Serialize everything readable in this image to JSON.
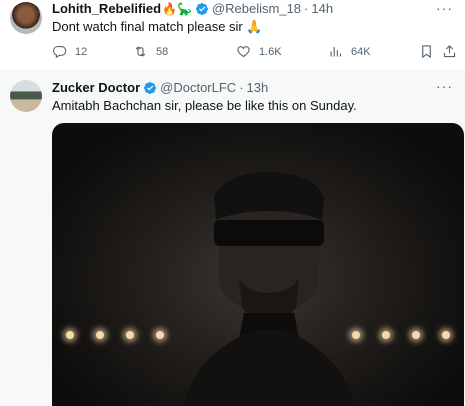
{
  "tweet1": {
    "name": "Lohith_Rebelified",
    "emojis": "🔥🦕",
    "handle": "@Rebelism_18",
    "time": "14h",
    "text": "Dont watch final match please sir 🙏",
    "stats": {
      "replies": "12",
      "retweets": "58",
      "likes": "1.6K",
      "views": "64K"
    }
  },
  "tweet2": {
    "name": "Zucker Doctor",
    "handle": "@DoctorLFC",
    "time": "13h",
    "text": "Amitabh Bachchan sir, please be like this on Sunday."
  },
  "separator": "·",
  "more_glyph": "···",
  "icons": {
    "reply": "reply-icon",
    "retweet": "retweet-icon",
    "like": "heart-icon",
    "views": "views-icon",
    "bookmark": "bookmark-icon",
    "share": "share-icon",
    "verified": "verified-badge-icon"
  },
  "colors": {
    "verified": "#1d9bf0",
    "text_primary": "#0f1419",
    "text_secondary": "#536471",
    "hover_background": "#f7f9f9"
  }
}
